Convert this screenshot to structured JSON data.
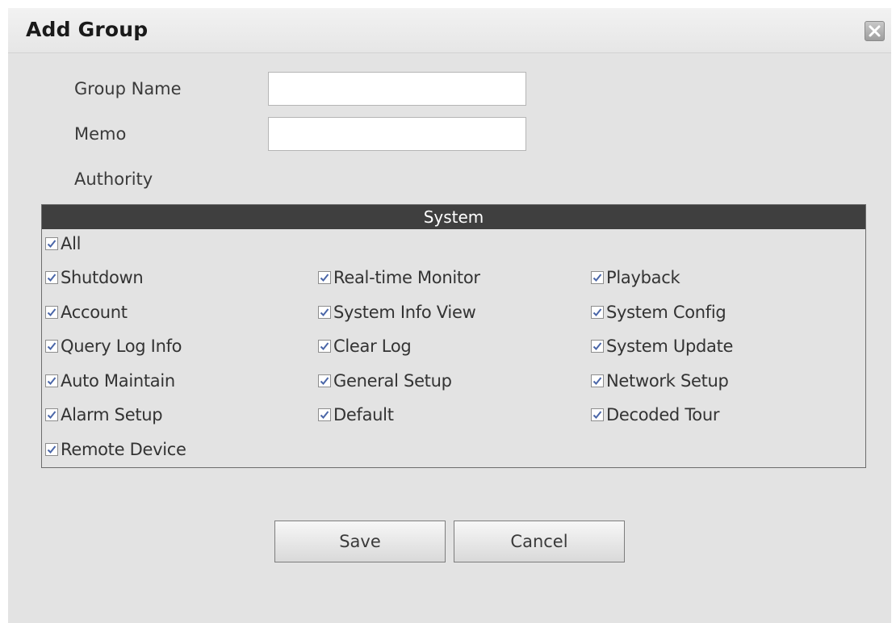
{
  "dialog": {
    "title": "Add Group",
    "close_icon": "close-icon"
  },
  "form": {
    "group_name_label": "Group Name",
    "group_name_value": "",
    "memo_label": "Memo",
    "memo_value": "",
    "authority_label": "Authority"
  },
  "authority": {
    "header": "System",
    "all": {
      "label": "All",
      "checked": true
    },
    "items": [
      {
        "label": "Shutdown",
        "checked": true
      },
      {
        "label": "Real-time Monitor",
        "checked": true
      },
      {
        "label": "Playback",
        "checked": true
      },
      {
        "label": "Account",
        "checked": true
      },
      {
        "label": "System Info View",
        "checked": true
      },
      {
        "label": "System Config",
        "checked": true
      },
      {
        "label": "Query Log Info",
        "checked": true
      },
      {
        "label": "Clear Log",
        "checked": true
      },
      {
        "label": "System Update",
        "checked": true
      },
      {
        "label": "Auto Maintain",
        "checked": true
      },
      {
        "label": "General Setup",
        "checked": true
      },
      {
        "label": "Network Setup",
        "checked": true
      },
      {
        "label": "Alarm Setup",
        "checked": true
      },
      {
        "label": "Default",
        "checked": true
      },
      {
        "label": "Decoded Tour",
        "checked": true
      },
      {
        "label": "Remote Device",
        "checked": true
      }
    ]
  },
  "buttons": {
    "save_label": "Save",
    "cancel_label": "Cancel"
  },
  "colors": {
    "dialog_bg": "#e3e3e3",
    "header_bg": "#3f3f3f",
    "check_color": "#4a66a8"
  }
}
